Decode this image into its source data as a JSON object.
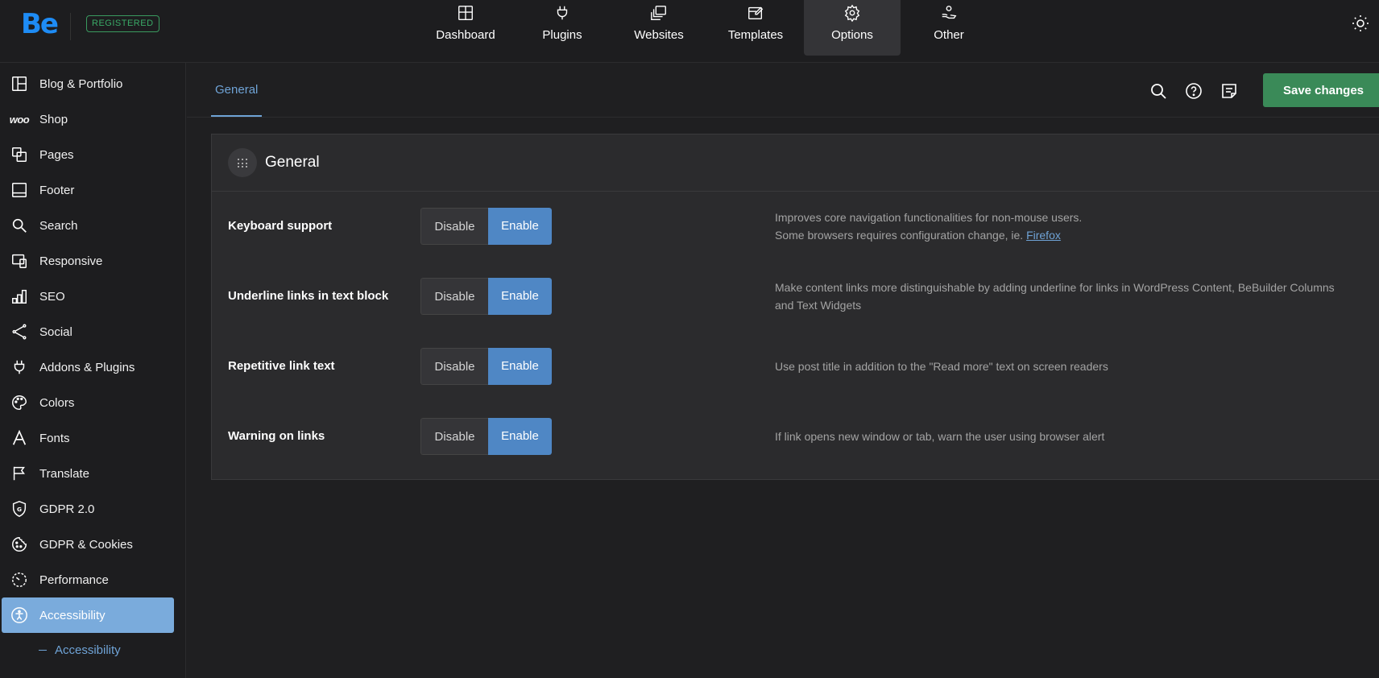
{
  "brand": {
    "logo": "Be",
    "badge": "REGISTERED"
  },
  "topnav": [
    {
      "label": "Dashboard",
      "icon": "dashboard-icon"
    },
    {
      "label": "Plugins",
      "icon": "plug-icon"
    },
    {
      "label": "Websites",
      "icon": "websites-icon"
    },
    {
      "label": "Templates",
      "icon": "templates-icon"
    },
    {
      "label": "Options",
      "icon": "gear-icon",
      "active": true
    },
    {
      "label": "Other",
      "icon": "hand-user-icon"
    }
  ],
  "sidebar": {
    "items": [
      {
        "label": "Blog & Portfolio",
        "icon": "layout-icon"
      },
      {
        "label": "Shop",
        "icon": "woo-icon",
        "icon_text": "woo"
      },
      {
        "label": "Pages",
        "icon": "pages-icon"
      },
      {
        "label": "Footer",
        "icon": "footer-icon"
      },
      {
        "label": "Search",
        "icon": "search-icon"
      },
      {
        "label": "Responsive",
        "icon": "devices-icon"
      },
      {
        "label": "SEO",
        "icon": "bars-icon"
      },
      {
        "label": "Social",
        "icon": "share-icon"
      },
      {
        "label": "Addons & Plugins",
        "icon": "plug-icon"
      },
      {
        "label": "Colors",
        "icon": "palette-icon"
      },
      {
        "label": "Fonts",
        "icon": "font-icon"
      },
      {
        "label": "Translate",
        "icon": "flag-icon"
      },
      {
        "label": "GDPR 2.0",
        "icon": "shield-g-icon"
      },
      {
        "label": "GDPR & Cookies",
        "icon": "cookie-icon"
      },
      {
        "label": "Performance",
        "icon": "gauge-icon"
      },
      {
        "label": "Accessibility",
        "icon": "accessibility-icon",
        "active": true
      }
    ],
    "subitem": "Accessibility"
  },
  "subheader": {
    "tab": "General",
    "save_label": "Save changes"
  },
  "panel": {
    "title": "General",
    "rows": [
      {
        "label": "Keyboard support",
        "disable": "Disable",
        "enable": "Enable",
        "selected": "Enable",
        "desc_line1": "Improves core navigation functionalities for non-mouse users.",
        "desc_line2": "Some browsers requires configuration change, ie.",
        "desc_link": "Firefox"
      },
      {
        "label": "Underline links in text block",
        "disable": "Disable",
        "enable": "Enable",
        "selected": "Enable",
        "desc_line1": "Make content links more distinguishable by adding underline for links in WordPress Content, BeBuilder Columns",
        "desc_line2": "and Text Widgets"
      },
      {
        "label": "Repetitive link text",
        "disable": "Disable",
        "enable": "Enable",
        "selected": "Enable",
        "desc_line1": "Use post title in addition to the \"Read more\" text on screen readers"
      },
      {
        "label": "Warning on links",
        "disable": "Disable",
        "enable": "Enable",
        "selected": "Enable",
        "desc_line1": "If link opens new window or tab, warn the user using browser alert"
      }
    ]
  },
  "colors": {
    "accent_blue": "#4f87c5",
    "active_sidebar": "#7aabdc",
    "save_green": "#3a8a58",
    "registered_green": "#3aaa67",
    "logo_blue": "#1e8cf5"
  }
}
